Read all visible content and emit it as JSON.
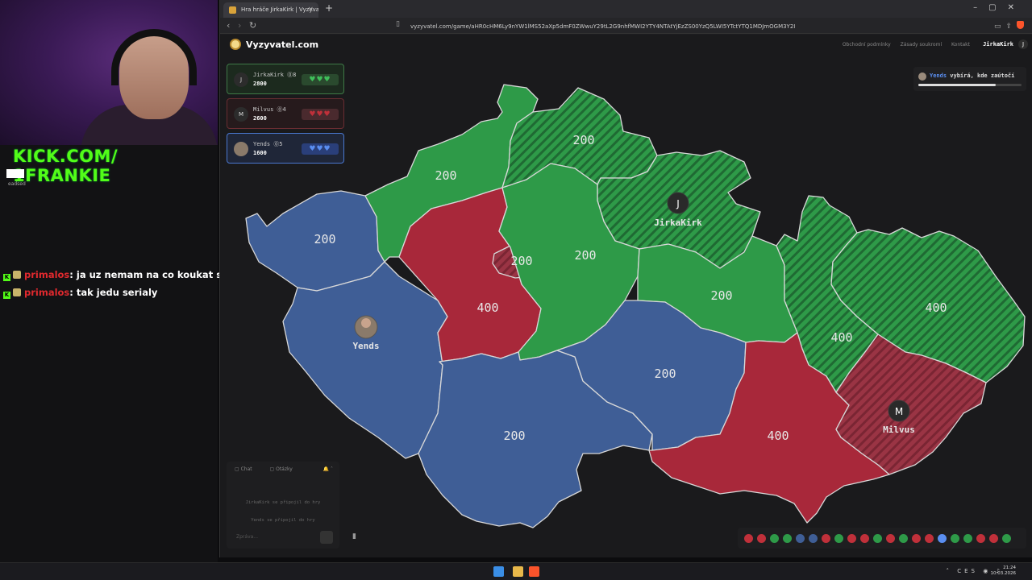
{
  "stream": {
    "kick_handle": "KICK.COM/ 1FRANKIE",
    "kick_sub": "eadsed",
    "chat": [
      {
        "user": "primalos",
        "text": ": ja uz nemam na co koukat skoro"
      },
      {
        "user": "primalos",
        "text": ": tak jedu serialy"
      }
    ]
  },
  "browser": {
    "tab_title": "Hra hráče JirkaKirk | Vyzyvatel...",
    "url": "vyzyvatel.com/game/aHR0cHM6Ly9nYW1lMS52aXp5dmF0ZWwuY29tL2G9nhfMWI2YTY4NTAtYjEzZS00YzQ5LWI5YTctYTQ1MDJmOGM3Y2I"
  },
  "site": {
    "logo": "Vyzyvatel.com",
    "links": [
      "Obchodní podmínky",
      "Zásady soukromí",
      "Kontakt"
    ],
    "user": "JirkaKirk",
    "user_initial": "J",
    "players": [
      {
        "name": "JirkaKirk",
        "lvl": "⓪8",
        "score": "2800",
        "initial": "J",
        "hearts": "♥♥♥",
        "color": "green"
      },
      {
        "name": "Milvus",
        "lvl": "⓪4",
        "score": "2600",
        "initial": "M",
        "hearts": "♥♥♥",
        "color": "red"
      },
      {
        "name": "Yends",
        "lvl": "⓪5",
        "score": "1600",
        "initial": "",
        "hearts": "♥♥♥",
        "color": "blue"
      }
    ],
    "turn": {
      "who": "Yends",
      "text": " vybírá, kde zaútočí",
      "progress": 0.75
    },
    "chat": {
      "tab_chat": "Chat",
      "tab_questions": "Otázky",
      "messages": [
        "JirkaKirk se připojil do hry",
        "Yends se připojil do hry"
      ],
      "placeholder": "Zpráva..."
    }
  },
  "map": {
    "regions": [
      {
        "id": "karlovarsky",
        "value": "200",
        "owner": "blue"
      },
      {
        "id": "ustecky",
        "value": "200",
        "owner": "green"
      },
      {
        "id": "liberecky",
        "value": "200",
        "owner": "green-hatched"
      },
      {
        "id": "kralovehradecky",
        "value": "",
        "owner": "green-hatched"
      },
      {
        "id": "plzensky",
        "value": "",
        "owner": "blue"
      },
      {
        "id": "stredocesky-west",
        "value": "400",
        "owner": "red"
      },
      {
        "id": "praha",
        "value": "200",
        "owner": "red-hatched"
      },
      {
        "id": "stredocesky-east",
        "value": "200",
        "owner": "green"
      },
      {
        "id": "pardubicky",
        "value": "200",
        "owner": "green"
      },
      {
        "id": "olomoucky",
        "value": "400",
        "owner": "green-hatched"
      },
      {
        "id": "moravskoslezsky",
        "value": "400",
        "owner": "green-hatched"
      },
      {
        "id": "jihocesky",
        "value": "200",
        "owner": "blue"
      },
      {
        "id": "vysocina",
        "value": "200",
        "owner": "blue"
      },
      {
        "id": "jihomoravsky",
        "value": "400",
        "owner": "red"
      },
      {
        "id": "zlinsky",
        "value": "",
        "owner": "red-hatched"
      }
    ],
    "markers": [
      {
        "name": "JirkaKirk",
        "initial": "J"
      },
      {
        "name": "Yends",
        "initial": ""
      },
      {
        "name": "Milvus",
        "initial": "M"
      }
    ],
    "colors": {
      "green": "#2e9a48",
      "red": "#a8283a",
      "blue": "#3f5e96",
      "bg": "#1a1a1c"
    }
  },
  "results": {
    "dots": [
      "red",
      "red",
      "green",
      "green",
      "blue",
      "blue",
      "red",
      "green",
      "red",
      "red",
      "green",
      "red",
      "green",
      "red",
      "red",
      "cross",
      "green",
      "green",
      "red",
      "red",
      "green"
    ]
  },
  "taskbar": {
    "time": "21:24",
    "date": "10.03.2026",
    "lang": "CES"
  }
}
